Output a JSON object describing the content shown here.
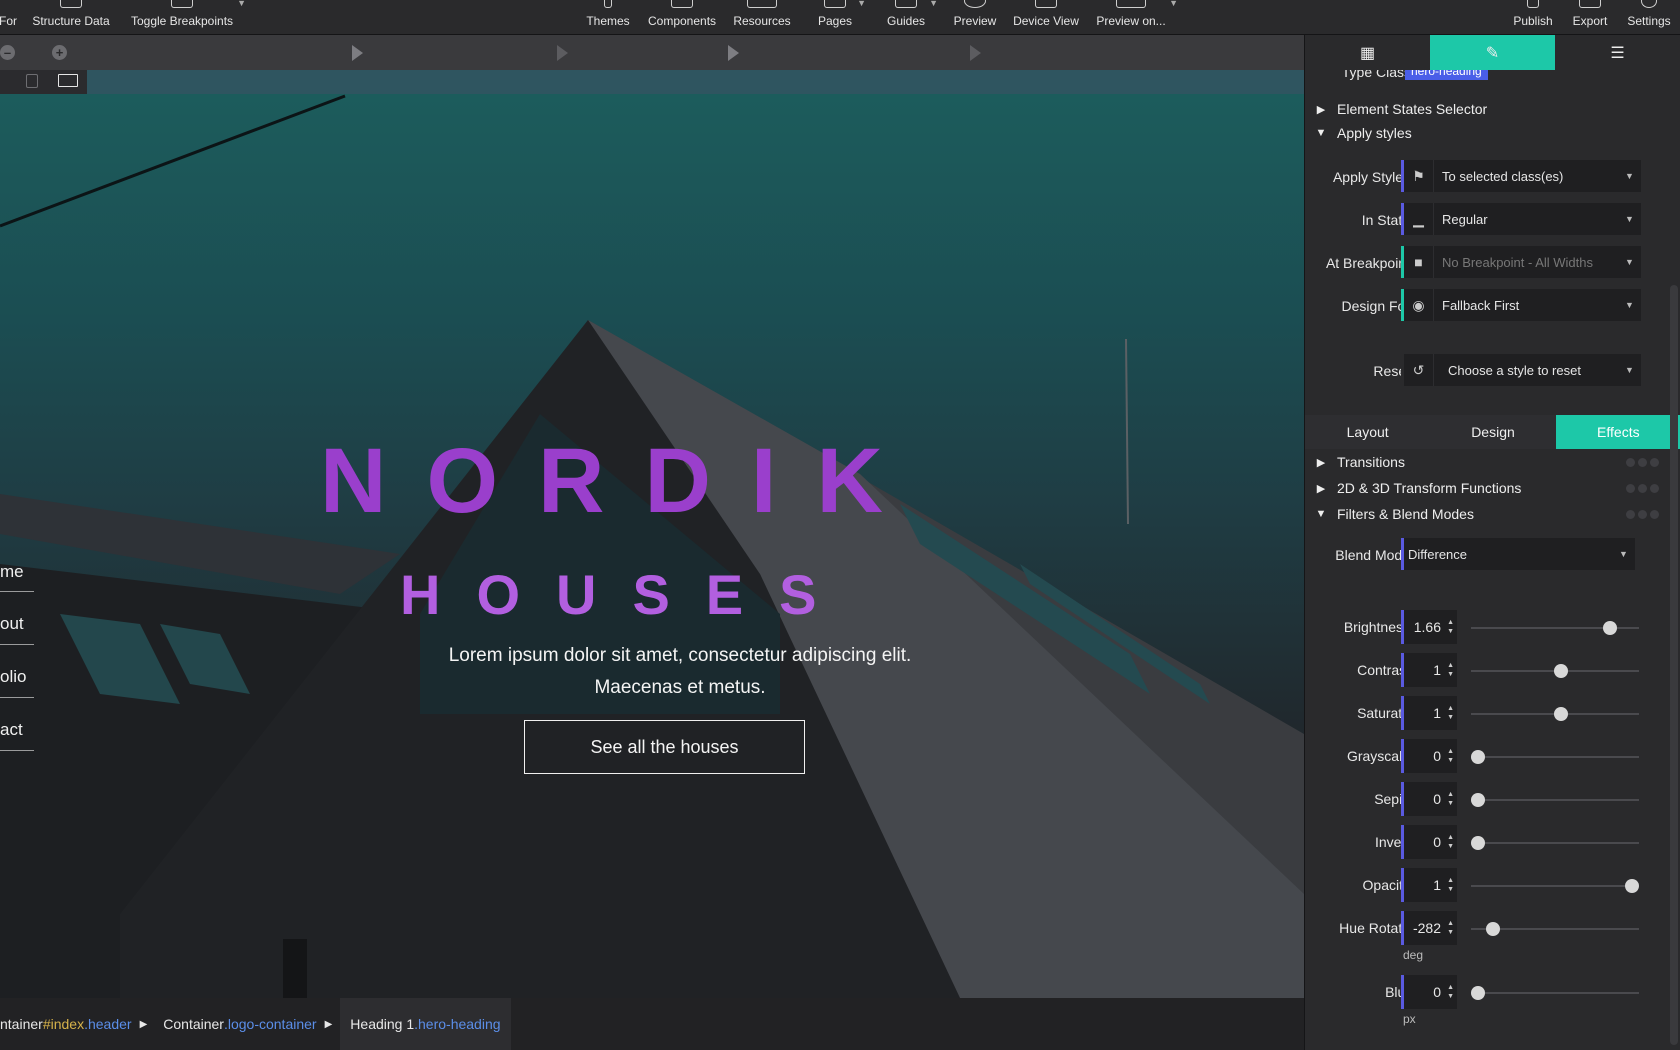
{
  "toolbar": {
    "items": [
      {
        "label": "For"
      },
      {
        "label": "Structure Data"
      },
      {
        "label": "Toggle Breakpoints"
      },
      {
        "label": "Themes"
      },
      {
        "label": "Components"
      },
      {
        "label": "Resources"
      },
      {
        "label": "Pages"
      },
      {
        "label": "Guides"
      },
      {
        "label": "Preview"
      },
      {
        "label": "Device View"
      },
      {
        "label": "Preview on..."
      },
      {
        "label": "Publish"
      },
      {
        "label": "Export"
      },
      {
        "label": "Settings"
      }
    ]
  },
  "timeline": {
    "zoom_out": "–",
    "zoom_in": "+"
  },
  "hero": {
    "nav": [
      "me",
      "out",
      "olio",
      "act"
    ],
    "heading": "NORDIK",
    "subheading": "HOUSES",
    "text_line1": "Lorem ipsum dolor sit amet, consectetur adipiscing elit.",
    "text_line2": "Maecenas et metus.",
    "button": "See all the houses"
  },
  "breadcrumb": [
    {
      "prefix": "ntainer",
      "id": "#index",
      "cls": ".header"
    },
    {
      "prefix": "Container",
      "id": "",
      "cls": ".logo-container"
    },
    {
      "prefix": "Heading 1",
      "id": "",
      "cls": ".hero-heading"
    }
  ],
  "panel": {
    "type_class_label": "Type Class",
    "type_class_value": "hero-heading",
    "section_states": "Element States Selector",
    "section_apply": "Apply styles",
    "apply_styles": {
      "label": "Apply Styles",
      "value": "To selected class(es)"
    },
    "in_state": {
      "label": "In State",
      "value": "Regular"
    },
    "at_breakpoint": {
      "label": "At Breakpoint",
      "value": "No Breakpoint - All Widths"
    },
    "design_for": {
      "label": "Design For",
      "value": "Fallback First"
    },
    "reset": {
      "label": "Reset",
      "value": "Choose a style to reset"
    },
    "subtabs": [
      "Layout",
      "Design",
      "Effects"
    ],
    "sections": [
      "Transitions",
      "2D & 3D Transform Functions",
      "Filters & Blend Modes"
    ],
    "blend_mode": {
      "label": "Blend Mode",
      "value": "Difference"
    },
    "filters": [
      {
        "label": "Brightness",
        "value": "1.66",
        "level": 0.86
      },
      {
        "label": "Contrast",
        "value": "1",
        "level": 0.54
      },
      {
        "label": "Saturate",
        "value": "1",
        "level": 0.54
      },
      {
        "label": "Grayscale",
        "value": "0",
        "level": 0.0
      },
      {
        "label": "Sepia",
        "value": "0",
        "level": 0.0
      },
      {
        "label": "Invert",
        "value": "0",
        "level": 0.0
      },
      {
        "label": "Opacity",
        "value": "1",
        "level": 1.0
      },
      {
        "label": "Hue Rotate",
        "value": "-282",
        "level": 0.1,
        "unit": "deg"
      },
      {
        "label": "Blur",
        "value": "0",
        "level": 0.0,
        "unit": "px"
      }
    ]
  },
  "colors": {
    "accent": "#1dc8a8",
    "field_marker": "#5a5ae0",
    "heading": "#9a3fcc"
  }
}
